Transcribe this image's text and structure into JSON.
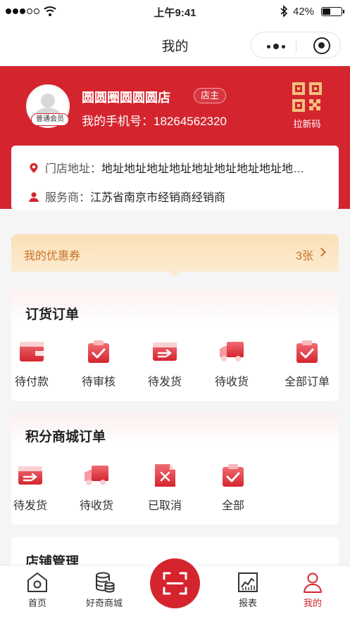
{
  "status_bar": {
    "time": "上午9:41",
    "battery": "42%",
    "battery_level": 0.42
  },
  "nav": {
    "title": "我的"
  },
  "profile": {
    "member_level": "普通会员",
    "store_name": "圆圆圈圆圆圆店",
    "role_tag": "店主",
    "phone_label": "我的手机号：",
    "phone": "18264562320",
    "invite_label": "拉新码"
  },
  "info": {
    "address_label": "门店地址：",
    "address_value": "地址地址地址地址地址地址地址地址地址地址",
    "provider_label": "服务商：",
    "provider_value": "江苏省南京市经销商经销商"
  },
  "coupon": {
    "label": "我的优惠券",
    "count": "3张"
  },
  "order_section": {
    "title": "订货订单",
    "items": [
      {
        "label": "待付款",
        "icon": "wallet-icon"
      },
      {
        "label": "待审核",
        "icon": "clipboard-check-icon"
      },
      {
        "label": "待发货",
        "icon": "box-arrow-icon"
      },
      {
        "label": "待收货",
        "icon": "truck-icon"
      },
      {
        "label": "全部订单",
        "icon": "clipboard-check-icon"
      }
    ]
  },
  "points_section": {
    "title": "积分商城订单",
    "items": [
      {
        "label": "待发货",
        "icon": "box-arrow-icon"
      },
      {
        "label": "待收货",
        "icon": "truck-icon"
      },
      {
        "label": "已取消",
        "icon": "document-x-icon"
      },
      {
        "label": "全部",
        "icon": "clipboard-check-icon"
      }
    ]
  },
  "store_section": {
    "title": "店铺管理"
  },
  "tab_bar": {
    "tabs": [
      {
        "label": "首页",
        "icon": "home-icon"
      },
      {
        "label": "好奇商城",
        "icon": "coins-icon"
      },
      {
        "label": "",
        "icon": "scan-icon"
      },
      {
        "label": "报表",
        "icon": "chart-icon"
      },
      {
        "label": "我的",
        "icon": "user-icon"
      }
    ],
    "active_color": "#d4252f"
  },
  "colors": {
    "brand_red": "#d4252f",
    "coupon_text": "#c7722a"
  }
}
